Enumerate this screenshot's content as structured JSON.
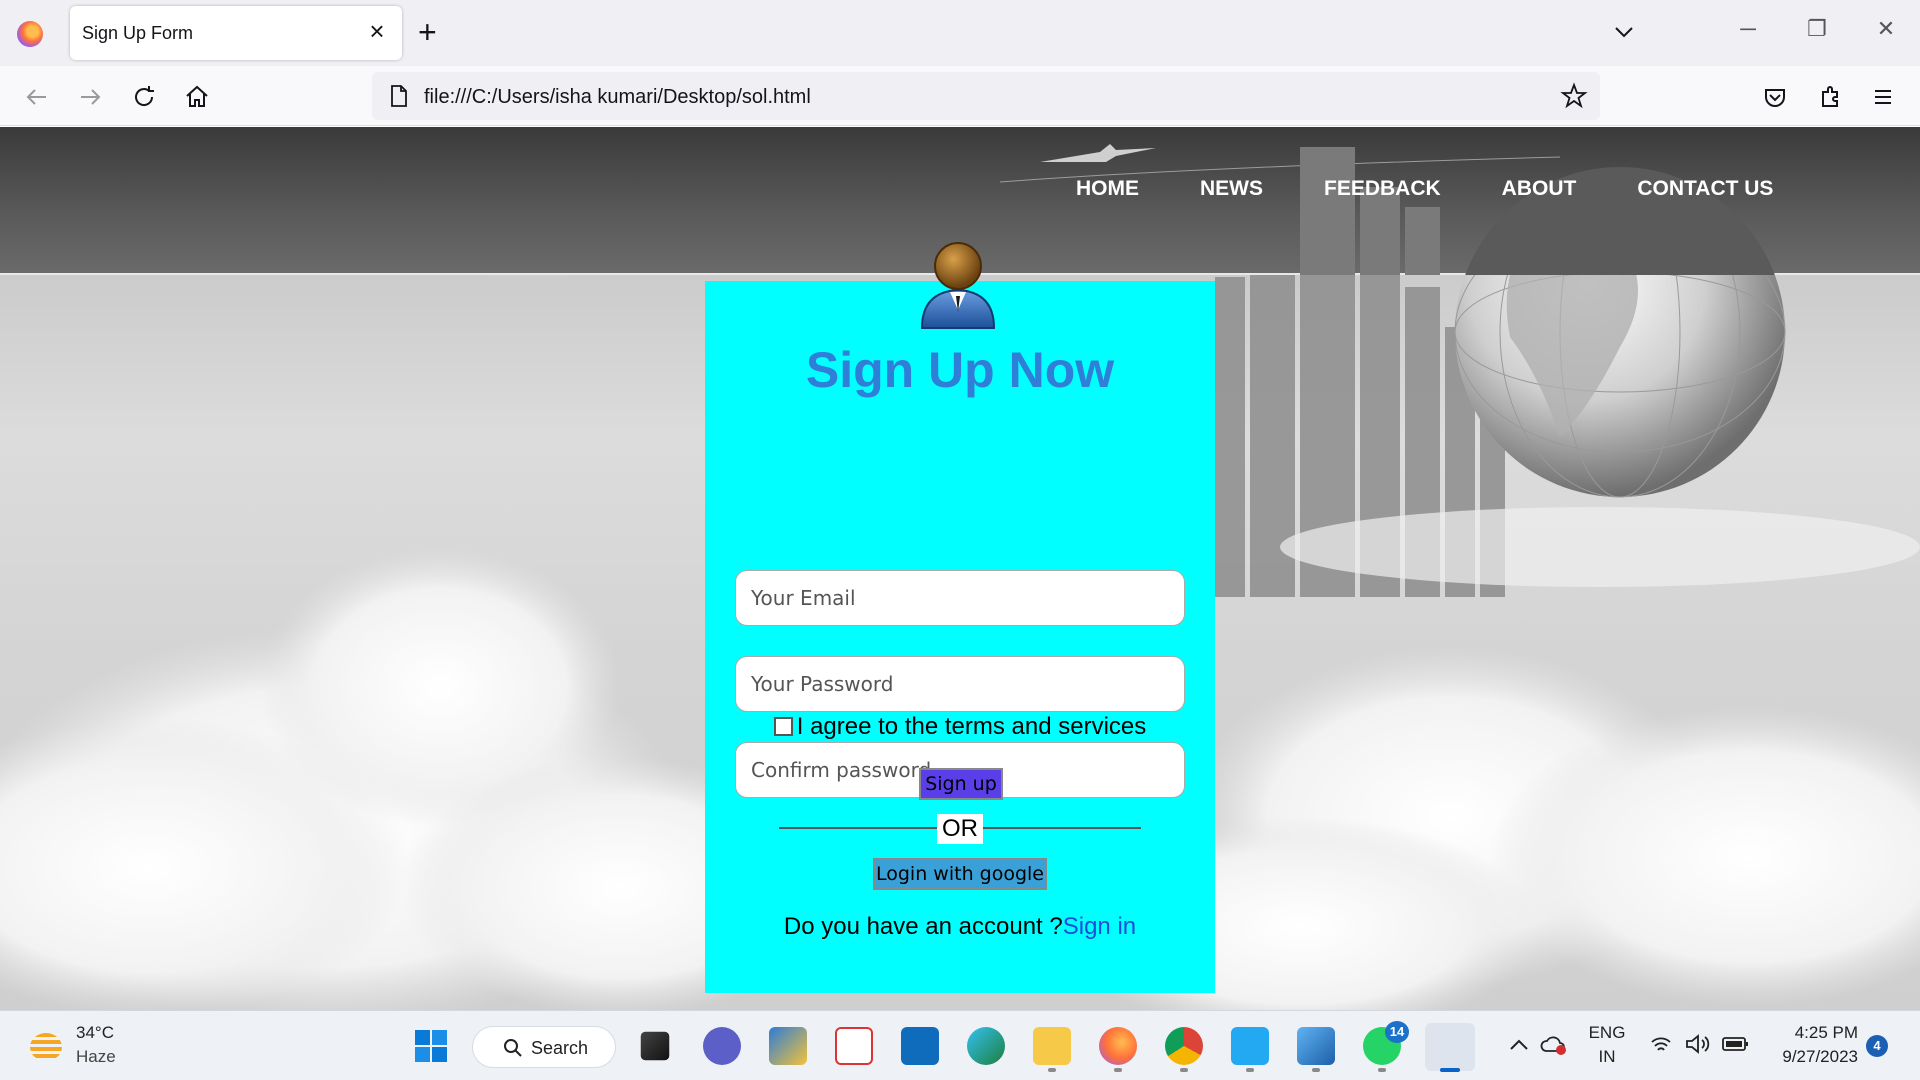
{
  "browser": {
    "tab_title": "Sign Up Form",
    "tab_close": "×",
    "new_tab": "+",
    "url": "file:///C:/Users/isha kumari/Desktop/sol.html",
    "minimize": "─",
    "restore": "❐",
    "close": "✕"
  },
  "site": {
    "menu": [
      "HOME",
      "NEWS",
      "FEEDBACK",
      "ABOUT",
      "CONTACT US"
    ]
  },
  "form": {
    "title": "Sign Up Now",
    "email_placeholder": "Your Email",
    "password_placeholder": "Your Password",
    "confirm_placeholder": "Confirm password",
    "agree_label": "I agree to the terms and services",
    "signup_button": "Sign up",
    "or_text": "OR",
    "google_button": "Login with google",
    "account_question": "Do you have an account ?",
    "signin_link": "Sign in"
  },
  "taskbar": {
    "temperature": "34°C",
    "weather": "Haze",
    "search_label": "Search",
    "whatsapp_badge": "14",
    "lang_top": "ENG",
    "lang_bottom": "IN",
    "time": "4:25 PM",
    "date": "9/27/2023",
    "notification_count": "4"
  },
  "colors": {
    "card": "#00ffff",
    "title": "#2f7ed8",
    "signup_button": "#5a3fe8",
    "google_button": "#3aa0d8",
    "link": "#1a4fd8"
  }
}
